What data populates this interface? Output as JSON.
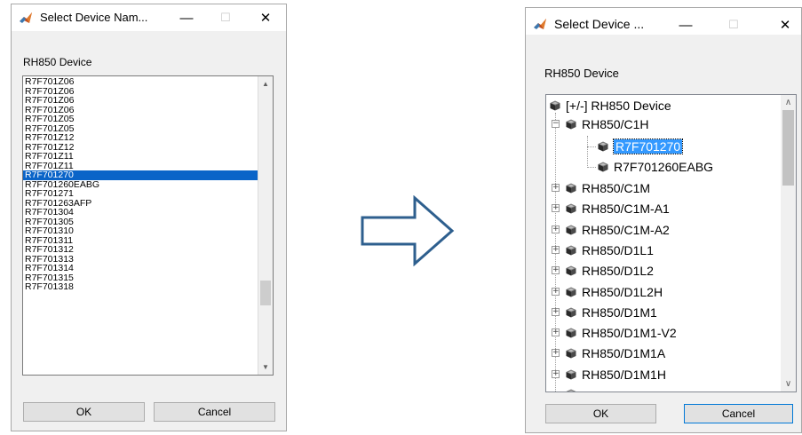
{
  "left_dialog": {
    "title": "Select Device Nam...",
    "section_label": "RH850 Device",
    "items": [
      "R7F701Z06",
      "R7F701Z06",
      "R7F701Z06",
      "R7F701Z06",
      "R7F701Z05",
      "R7F701Z05",
      "R7F701Z12",
      "R7F701Z12",
      "R7F701Z11",
      "R7F701Z11",
      "R7F701270",
      "R7F701260EABG",
      "R7F701271",
      "R7F701263AFP",
      "R7F701304",
      "R7F701305",
      "R7F701310",
      "R7F701311",
      "R7F701312",
      "R7F701313",
      "R7F701314",
      "R7F701315",
      "R7F701318"
    ],
    "selected_index": 10,
    "ok_label": "OK",
    "cancel_label": "Cancel"
  },
  "right_dialog": {
    "title": "Select Device ...",
    "section_label": "RH850 Device",
    "tree": {
      "root": "[+/-] RH850 Device",
      "expanded_group": "RH850/C1H",
      "children": [
        "R7F701270",
        "R7F701260EABG"
      ],
      "selected": "R7F701270",
      "groups": [
        "RH850/C1M",
        "RH850/C1M-A1",
        "RH850/C1M-A2",
        "RH850/D1L1",
        "RH850/D1L2",
        "RH850/D1L2H",
        "RH850/D1M1",
        "RH850/D1M1-V2",
        "RH850/D1M1A",
        "RH850/D1M1H"
      ]
    },
    "ok_label": "OK",
    "cancel_label": "Cancel"
  },
  "window_controls": {
    "minimize": "—",
    "maximize": "☐",
    "close": "✕"
  },
  "colors": {
    "selection_list": "#0a64c8",
    "selection_tree": "#3399ff",
    "arrow_stroke": "#2e5f8e"
  }
}
